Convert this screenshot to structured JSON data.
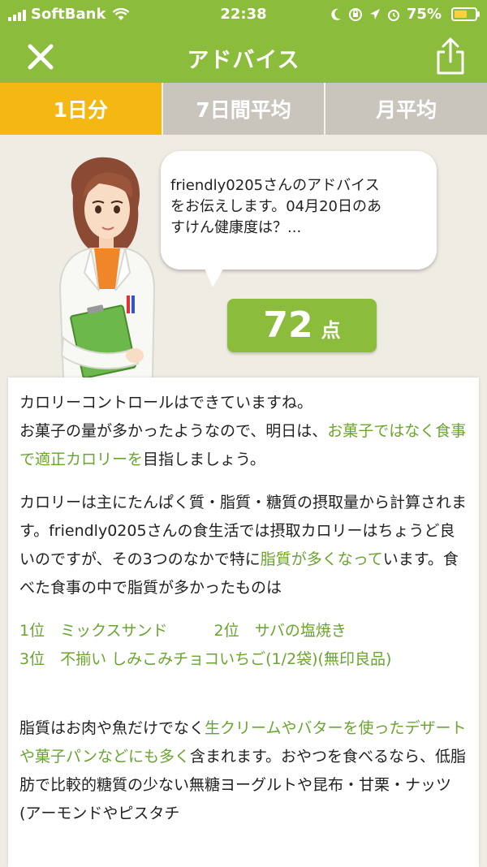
{
  "status_bar": {
    "carrier": "SoftBank",
    "time": "22:38",
    "battery_percent": "75%",
    "battery_level": 0.75,
    "icons": [
      "signal-icon",
      "wifi-icon",
      "moon-icon",
      "orientation-lock-icon",
      "location-icon",
      "alarm-icon",
      "battery-icon"
    ]
  },
  "header": {
    "title": "アドバイス",
    "close_icon": "close-icon",
    "share_icon": "share-icon"
  },
  "tabs": [
    {
      "label": "1日分",
      "active": true
    },
    {
      "label": "7日間平均",
      "active": false
    },
    {
      "label": "月平均",
      "active": false
    }
  ],
  "speech": {
    "text": "friendly0205さんのアドバイス\nをお伝えします。04月20日のあ\nすけん健康度は？..."
  },
  "score": {
    "value": "72",
    "unit": "点"
  },
  "advice": {
    "p1": {
      "line1": "カロリーコントロールはできていますね。",
      "line2_prefix": "お菓子の量が多かったようなので、明日は、",
      "line2_highlight": "お菓子ではなく食事で適正カロリーを",
      "line2_suffix": "目指しましょう。"
    },
    "p2": {
      "prefix": "カロリーは主にたんぱく質・脂質・糖質の摂取量から計算されます。friendly0205さんの食生活では摂取カロリーはちょうど良いのですが、その3つのなかで特に",
      "highlight": "脂質が多くなって",
      "suffix": "います。食べた食事の中で脂質が多かったものは"
    },
    "rankings": {
      "line1": "1位　ミックスサンド　　　2位　サバの塩焼き",
      "line2": "3位　不揃い しみこみチョコいちご(1/2袋)(無印良品)"
    },
    "p3": {
      "prefix": "脂質はお肉や魚だけでなく",
      "highlight": "生クリームやバターを使ったデザートや菓子パンなどにも多く",
      "suffix": "含まれます。おやつを食べるなら、低脂肪で比較的糖質の少ない無糖ヨーグルトや昆布・甘栗・ナッツ(アーモンドやピスタチ"
    }
  },
  "colors": {
    "brand_green": "#8cbc3c",
    "highlight_green": "#6aa52e",
    "active_tab": "#f5b812",
    "inactive_tab": "#c9c5bd",
    "background": "#efece4"
  }
}
